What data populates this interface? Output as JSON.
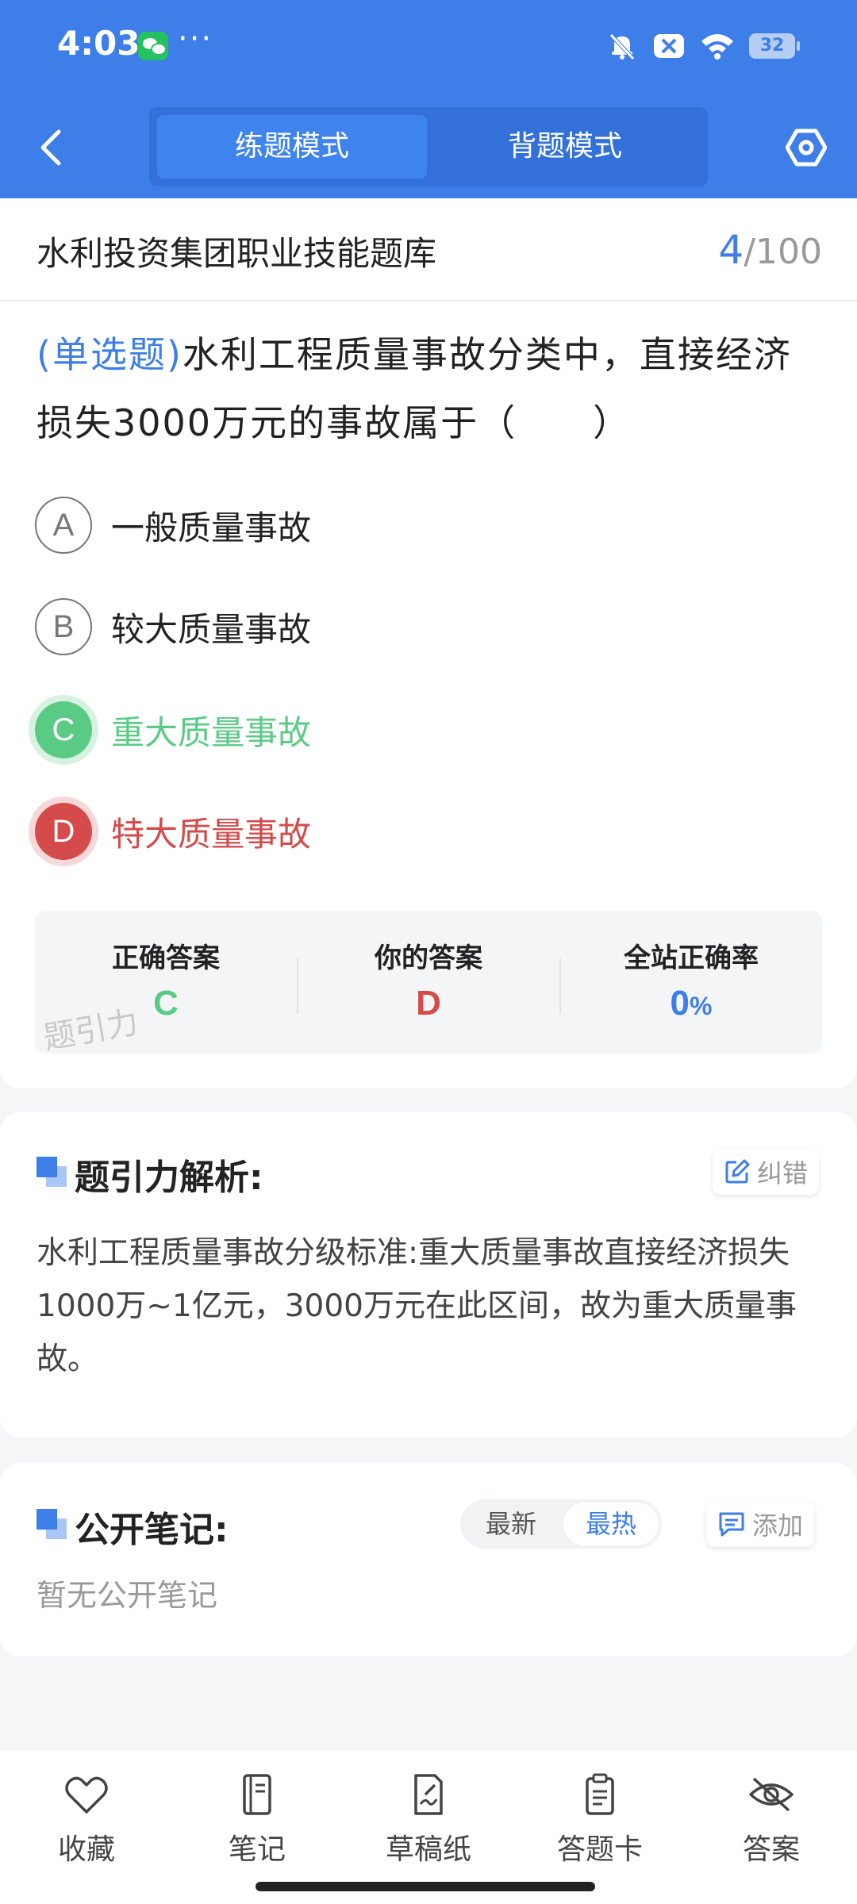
{
  "status_bar": {
    "time": "4:03",
    "battery": "32"
  },
  "mode_switch": {
    "practice": "练题模式",
    "memorize": "背题模式"
  },
  "bank": {
    "title": "水利投资集团职业技能题库",
    "current": "4",
    "total": "/100"
  },
  "question": {
    "type": "(单选题)",
    "text": "水利工程质量事故分类中，直接经济损失3000万元的事故属于（　　）",
    "options": [
      {
        "letter": "A",
        "text": "一般质量事故",
        "state": "normal"
      },
      {
        "letter": "B",
        "text": "较大质量事故",
        "state": "normal"
      },
      {
        "letter": "C",
        "text": "重大质量事故",
        "state": "correct"
      },
      {
        "letter": "D",
        "text": "特大质量事故",
        "state": "wrong"
      }
    ]
  },
  "answers": {
    "correct_label": "正确答案",
    "correct_value": "C",
    "yours_label": "你的答案",
    "yours_value": "D",
    "rate_label": "全站正确率",
    "rate_value": "0",
    "rate_unit": "%",
    "watermark": "题引力"
  },
  "analysis": {
    "title": "题引力解析:",
    "report_button": "纠错",
    "text": "水利工程质量事故分级标准:重大质量事故直接经济损失1000万~1亿元，3000万元在此区间，故为重大质量事故。"
  },
  "notes": {
    "title": "公开笔记:",
    "sort_latest": "最新",
    "sort_hot": "最热",
    "add_button": "添加",
    "empty": "暂无公开笔记"
  },
  "bottom_tabs": [
    "收藏",
    "笔记",
    "草稿纸",
    "答题卡",
    "答案"
  ],
  "colors": {
    "primary": "#3d7ee8",
    "correct": "#5acb84",
    "wrong": "#d54a4a"
  }
}
